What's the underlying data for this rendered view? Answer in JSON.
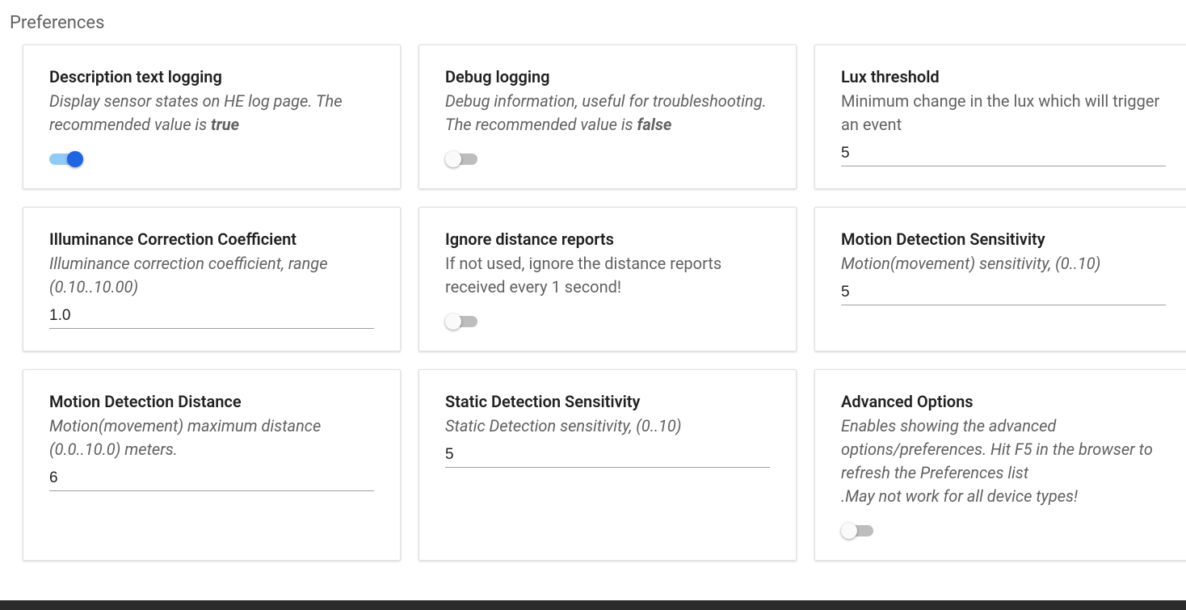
{
  "page": {
    "title": "Preferences"
  },
  "cards": {
    "txtlog": {
      "title": "Description text logging",
      "desc_pre": "Display sensor states on HE log page. The recommended value is ",
      "desc_bold": "true",
      "toggle_on": true
    },
    "dbglog": {
      "title": "Debug logging",
      "desc_pre": "Debug information, useful for troubleshooting. The recommended value is ",
      "desc_bold": "false",
      "toggle_on": false
    },
    "lux": {
      "title": "Lux threshold",
      "desc": "Minimum change in the lux which will trigger an event",
      "value": "5"
    },
    "illum": {
      "title": "Illuminance Correction Coefficient",
      "desc": "Illuminance correction coefficient, range (0.10..10.00)",
      "value": "1.0"
    },
    "ignoredist": {
      "title": "Ignore distance reports",
      "desc": "If not used, ignore the distance reports received every 1 second!",
      "toggle_on": false
    },
    "motionsens": {
      "title": "Motion Detection Sensitivity",
      "desc": "Motion(movement) sensitivity, (0..10)",
      "value": "5"
    },
    "motiondist": {
      "title": "Motion Detection Distance",
      "desc": "Motion(movement) maximum distance (0.0..10.0) meters.",
      "value": "6"
    },
    "staticsens": {
      "title": "Static Detection Sensitivity",
      "desc": "Static Detection sensitivity, (0..10)",
      "value": "5"
    },
    "adv": {
      "title": "Advanced Options",
      "desc_l1": "Enables showing the advanced options/preferences. Hit F5 in the browser to refresh the Preferences list",
      "desc_l2": ".May not work for all device types!",
      "toggle_on": false
    }
  }
}
